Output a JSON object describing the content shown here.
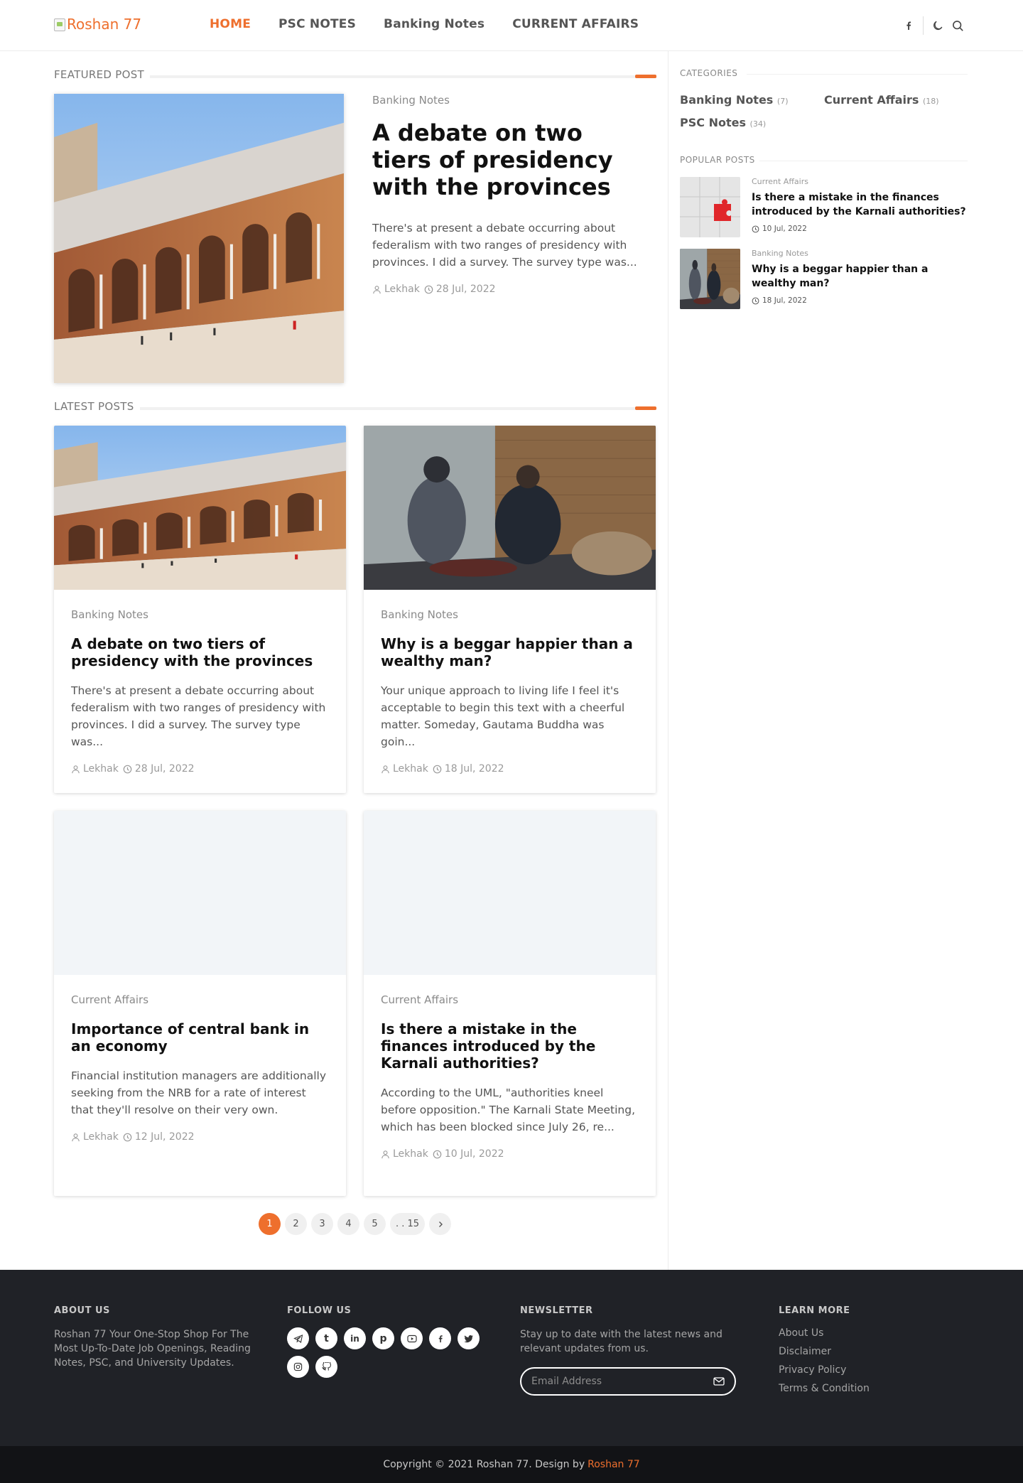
{
  "brand": {
    "logo_alt": "Roshan 77",
    "accent": "#ee6f2d"
  },
  "nav": {
    "items": [
      {
        "label": "HOME",
        "active": true
      },
      {
        "label": "PSC NOTES",
        "active": false
      },
      {
        "label": "Banking Notes",
        "active": false
      },
      {
        "label": "CURRENT AFFAIRS",
        "active": false
      }
    ],
    "icons": [
      "facebook-icon",
      "moon-icon",
      "search-icon"
    ]
  },
  "featured": {
    "heading": "FEATURED POST",
    "post": {
      "category": "Banking Notes",
      "title": "A debate on two tiers of presidency with the provinces",
      "excerpt": "There's at present a debate occurring about federalism with two ranges of presidency with provinces. I did a survey. The survey type was...",
      "author": "Lekhak",
      "date": "28 Jul, 2022"
    }
  },
  "latest": {
    "heading": "LATEST POSTS",
    "posts": [
      {
        "category": "Banking Notes",
        "title": "A debate on two tiers of presidency with the provinces",
        "excerpt": "There's at present a debate occurring about federalism with two ranges of presidency with provinces. I did a survey. The survey type was...",
        "author": "Lekhak",
        "date": "28 Jul, 2022"
      },
      {
        "category": "Banking Notes",
        "title": "Why is a beggar happier than a wealthy man?",
        "excerpt": "Your unique approach to living life I feel it's acceptable to begin this text with a cheerful matter. Someday, Gautama Buddha was goin...",
        "author": "Lekhak",
        "date": "18 Jul, 2022"
      },
      {
        "category": "Current Affairs",
        "title": "Importance of central bank in an economy",
        "excerpt": "Financial institution managers are additionally seeking from the NRB for a rate of interest that they'll resolve on their very own.",
        "author": "Lekhak",
        "date": "12 Jul, 2022"
      },
      {
        "category": "Current Affairs",
        "title": "Is there a mistake in the finances introduced by the Karnali authorities?",
        "excerpt": "According to the UML, \"authorities kneel before opposition.\" The Karnali State Meeting, which has been blocked since July 26, re...",
        "author": "Lekhak",
        "date": "10 Jul, 2022"
      }
    ]
  },
  "pagination": {
    "pages": [
      "1",
      "2",
      "3",
      "4",
      "5",
      ". . 15"
    ],
    "current": "1",
    "next_icon": "chevron-right-icon"
  },
  "sidebar": {
    "categories_title": "CATEGORIES",
    "categories": [
      {
        "name": "Banking Notes",
        "count": "(7)"
      },
      {
        "name": "Current Affairs",
        "count": "(18)"
      },
      {
        "name": "PSC Notes",
        "count": "(34)"
      }
    ],
    "popular_title": "POPULAR POSTS",
    "popular": [
      {
        "category": "Current Affairs",
        "title": "Is there a mistake in the finances introduced by the Karnali authorities?",
        "date": "10 Jul, 2022"
      },
      {
        "category": "Banking Notes",
        "title": "Why is a beggar happier than a wealthy man?",
        "date": "18 Jul, 2022"
      }
    ]
  },
  "footer": {
    "about": {
      "heading": "ABOUT US",
      "text": "Roshan 77 Your One-Stop Shop For The Most Up-To-Date Job Openings, Reading Notes, PSC, and University Updates."
    },
    "follow": {
      "heading": "FOLLOW US",
      "icons": [
        "telegram-icon",
        "tumblr-icon",
        "linkedin-icon",
        "pinterest-icon",
        "youtube-icon",
        "facebook-icon",
        "twitter-icon",
        "instagram-icon",
        "github-icon"
      ]
    },
    "newsletter": {
      "heading": "NEWSLETTER",
      "text": "Stay up to date with the latest news and relevant updates from us.",
      "placeholder": "Email Address"
    },
    "learn": {
      "heading": "LEARN MORE",
      "links": [
        "About Us",
        "Disclaimer",
        "Privacy Policy",
        "Terms & Condition"
      ]
    }
  },
  "copyright": {
    "prefix": "Copyright © 2021 Roshan 77. Design by",
    "designer": "Roshan 77"
  }
}
